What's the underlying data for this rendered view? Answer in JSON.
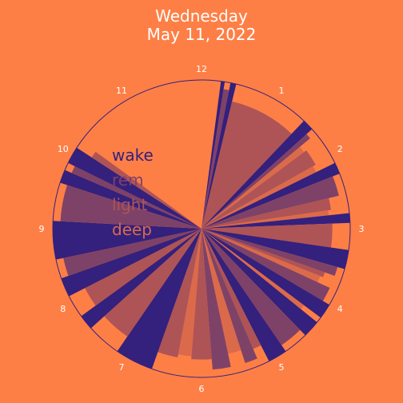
{
  "title_line1": "Wednesday",
  "title_line2": "May 11, 2022",
  "chart_data": {
    "type": "polar-bar",
    "title": "Wednesday May 11, 2022",
    "hour_labels": [
      "12",
      "1",
      "2",
      "3",
      "4",
      "5",
      "6",
      "7",
      "8",
      "9",
      "10",
      "11"
    ],
    "legend": [
      {
        "name": "wake",
        "color": "#34207d"
      },
      {
        "name": "rem",
        "color": "#7e4268"
      },
      {
        "name": "light",
        "color": "#ae5456"
      },
      {
        "name": "deep",
        "color": "#db6a4b"
      }
    ],
    "series": [
      {
        "start": 0.5,
        "end": 0.6,
        "stage": "wake",
        "depth": 1.0
      },
      {
        "start": 0.6,
        "end": 0.75,
        "stage": "rem",
        "depth": 0.95
      },
      {
        "start": 0.75,
        "end": 0.9,
        "stage": "wake",
        "depth": 1.0
      },
      {
        "start": 0.9,
        "end": 2.9,
        "stage": "light",
        "depth": 0.88
      },
      {
        "start": 2.9,
        "end": 3.2,
        "stage": "wake",
        "depth": 1.0
      },
      {
        "start": 3.2,
        "end": 3.35,
        "stage": "rem",
        "depth": 0.95
      },
      {
        "start": 3.35,
        "end": 3.55,
        "stage": "deep",
        "depth": 0.86
      },
      {
        "start": 3.55,
        "end": 4.05,
        "stage": "light",
        "depth": 0.88
      },
      {
        "start": 4.05,
        "end": 4.25,
        "stage": "deep",
        "depth": 0.86
      },
      {
        "start": 4.25,
        "end": 4.55,
        "stage": "wake",
        "depth": 1.0
      },
      {
        "start": 4.55,
        "end": 5.1,
        "stage": "rem",
        "depth": 0.95
      },
      {
        "start": 5.1,
        "end": 5.45,
        "stage": "light",
        "depth": 0.88
      },
      {
        "start": 5.45,
        "end": 5.6,
        "stage": "deep",
        "depth": 0.86
      },
      {
        "start": 5.6,
        "end": 5.85,
        "stage": "wake",
        "depth": 1.0
      },
      {
        "start": 5.85,
        "end": 6.55,
        "stage": "light",
        "depth": 0.88
      },
      {
        "start": 6.55,
        "end": 7.05,
        "stage": "wake",
        "depth": 1.0
      },
      {
        "start": 7.05,
        "end": 7.3,
        "stage": "rem",
        "depth": 0.95
      },
      {
        "start": 7.3,
        "end": 7.45,
        "stage": "light",
        "depth": 0.88
      },
      {
        "start": 7.45,
        "end": 7.65,
        "stage": "deep",
        "depth": 0.86
      },
      {
        "start": 7.65,
        "end": 8.05,
        "stage": "rem",
        "depth": 0.95
      },
      {
        "start": 8.05,
        "end": 8.45,
        "stage": "wake",
        "depth": 1.0
      },
      {
        "start": 8.45,
        "end": 8.6,
        "stage": "deep",
        "depth": 0.86
      },
      {
        "start": 8.6,
        "end": 9.05,
        "stage": "wake",
        "depth": 1.0
      },
      {
        "start": 9.05,
        "end": 9.7,
        "stage": "rem",
        "depth": 0.95
      },
      {
        "start": 9.7,
        "end": 10.2,
        "stage": "wake",
        "depth": 1.0
      },
      {
        "start": 10.2,
        "end": 10.45,
        "stage": "light",
        "depth": 0.88
      },
      {
        "start": 10.45,
        "end": 10.8,
        "stage": "rem",
        "depth": 0.95
      },
      {
        "start": 10.8,
        "end": 11.2,
        "stage": "deep",
        "depth": 0.86
      },
      {
        "start": 11.2,
        "end": 11.7,
        "stage": "rem",
        "depth": 0.95
      },
      {
        "start": 11.7,
        "end": 12.3,
        "stage": "light",
        "depth": 0.88
      },
      {
        "start": 12.3,
        "end": 12.7,
        "stage": "deep",
        "depth": 0.86
      },
      {
        "start": 12.7,
        "end": 13.3,
        "stage": "light",
        "depth": 0.88
      },
      {
        "start": 13.3,
        "end": 14.3,
        "stage": "wake",
        "depth": 1.0
      },
      {
        "start": 14.3,
        "end": 15.2,
        "stage": "light",
        "depth": 0.88
      },
      {
        "start": 15.2,
        "end": 15.6,
        "stage": "wake",
        "depth": 1.0
      },
      {
        "start": 15.6,
        "end": 16.2,
        "stage": "light",
        "depth": 0.88
      },
      {
        "start": 16.2,
        "end": 16.7,
        "stage": "wake",
        "depth": 1.0
      },
      {
        "start": 16.7,
        "end": 17.2,
        "stage": "rem",
        "depth": 0.95
      },
      {
        "start": 17.2,
        "end": 18.2,
        "stage": "wake",
        "depth": 1.0
      },
      {
        "start": 18.2,
        "end": 19.2,
        "stage": "rem",
        "depth": 0.95
      },
      {
        "start": 19.2,
        "end": 19.55,
        "stage": "wake",
        "depth": 1.0
      },
      {
        "start": 19.55,
        "end": 19.75,
        "stage": "rem",
        "depth": 0.95
      },
      {
        "start": 19.75,
        "end": 20.2,
        "stage": "wake",
        "depth": 1.0
      },
      {
        "start": 20.2,
        "end": 20.4,
        "stage": "light",
        "depth": 0.88
      }
    ],
    "outline_circle": true
  }
}
